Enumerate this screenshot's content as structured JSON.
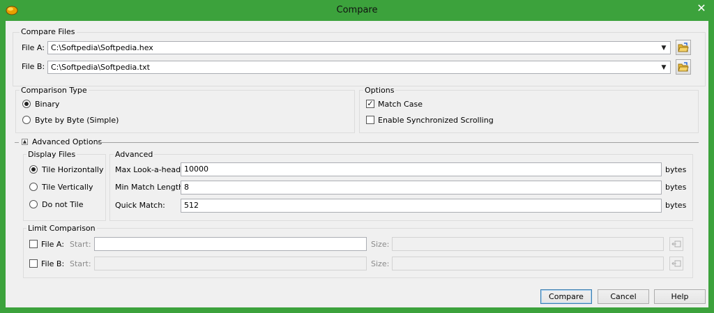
{
  "window": {
    "title": "Compare",
    "close_glyph": "✕"
  },
  "compare_files": {
    "legend": "Compare Files",
    "file_a_label": "File A:",
    "file_a_value": "C:\\Softpedia\\Softpedia.hex",
    "file_b_label": "File B:",
    "file_b_value": "C:\\Softpedia\\Softpedia.txt"
  },
  "comparison_type": {
    "legend": "Comparison Type",
    "options": [
      "Binary",
      "Byte by Byte (Simple)"
    ],
    "selected": "Binary"
  },
  "options": {
    "legend": "Options",
    "match_case": {
      "label": "Match Case",
      "checked": true
    },
    "sync_scrolling": {
      "label": "Enable Synchronized Scrolling",
      "checked": false
    }
  },
  "advanced_options": {
    "label": "Advanced Options",
    "display_files": {
      "legend": "Display Files",
      "options": [
        "Tile Horizontally",
        "Tile Vertically",
        "Do not Tile"
      ],
      "selected": "Tile Horizontally"
    },
    "advanced": {
      "legend": "Advanced",
      "max_lookahead_label": "Max Look-a-head:",
      "max_lookahead_value": "10000",
      "min_match_label": "Min Match Length:",
      "min_match_value": "8",
      "quick_match_label": "Quick Match:",
      "quick_match_value": "512",
      "unit": "bytes"
    },
    "limit_comparison": {
      "legend": "Limit Comparison",
      "file_a_label": "File A:",
      "file_b_label": "File B:",
      "start_label": "Start:",
      "size_label": "Size:"
    }
  },
  "buttons": {
    "compare": "Compare",
    "cancel": "Cancel",
    "help": "Help"
  },
  "colors": {
    "title_bar": "#3ca23c",
    "client_bg": "#f0f0f0",
    "default_button_border": "#3c7fb1"
  }
}
